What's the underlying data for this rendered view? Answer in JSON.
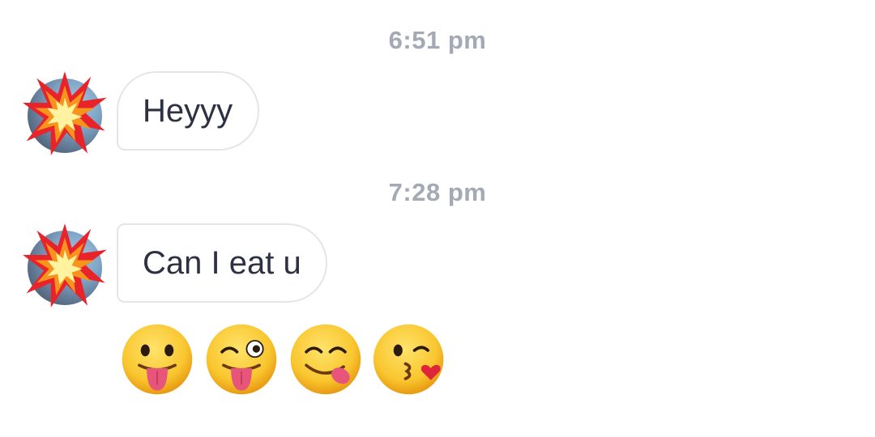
{
  "messages": [
    {
      "timestamp": "6:51 pm",
      "text": "Heyyy"
    },
    {
      "timestamp": "7:28 pm",
      "text": "Can I eat u"
    }
  ],
  "emoji_reactions": [
    "face-with-tongue",
    "winking-face-with-tongue",
    "face-savoring-food",
    "face-blowing-kiss"
  ],
  "avatar_icon": "collision-icon",
  "colors": {
    "timestamp": "#a4a9b6",
    "bubble_border": "#e3e5ea",
    "message_text": "#2d3142",
    "emoji_face": "#f9c62f"
  }
}
